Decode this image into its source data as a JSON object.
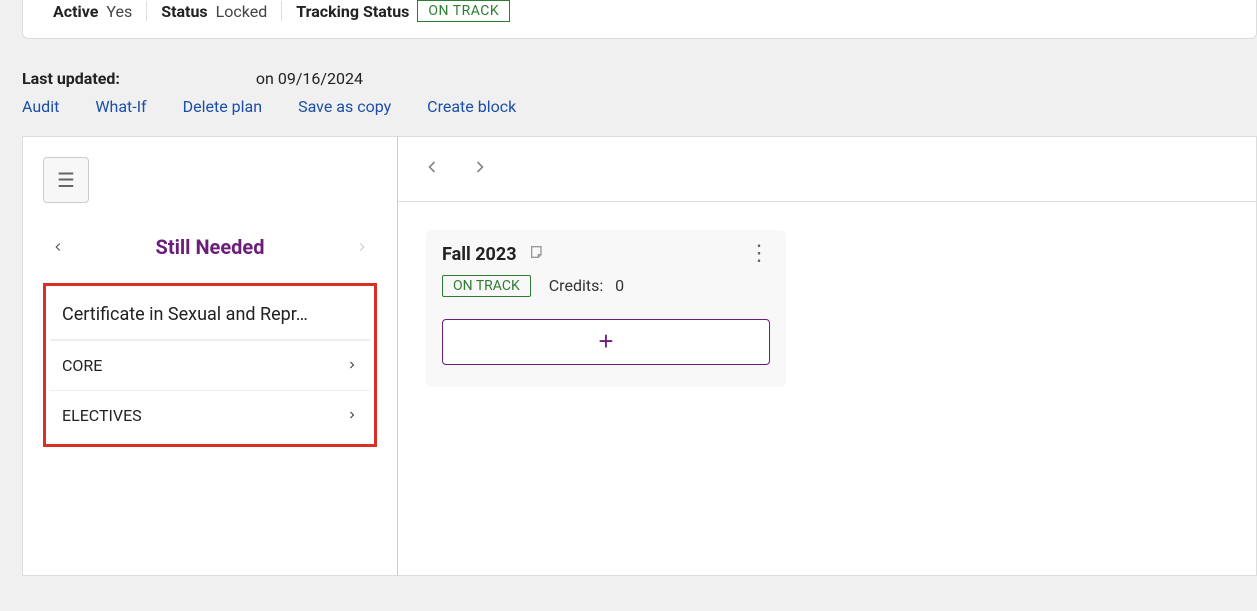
{
  "banner": {
    "active_label": "Active",
    "active_value": "Yes",
    "status_label": "Status",
    "status_value": "Locked",
    "tracking_label": "Tracking Status",
    "tracking_value": "ON TRACK"
  },
  "meta": {
    "last_updated_label": "Last updated:",
    "on_text": " on ",
    "date": "09/16/2024"
  },
  "actions": {
    "audit": "Audit",
    "whatif": "What-If",
    "delete": "Delete plan",
    "saveas": "Save as copy",
    "createblock": "Create block"
  },
  "sidebar": {
    "title": "Still Needed",
    "program": "Certificate in Sexual and Repr…",
    "items": [
      {
        "label": "CORE"
      },
      {
        "label": "ELECTIVES"
      }
    ]
  },
  "term": {
    "title": "Fall 2023",
    "status": "ON TRACK",
    "credits_label": "Credits:",
    "credits_value": "0"
  },
  "icons": {
    "plus": "+"
  }
}
